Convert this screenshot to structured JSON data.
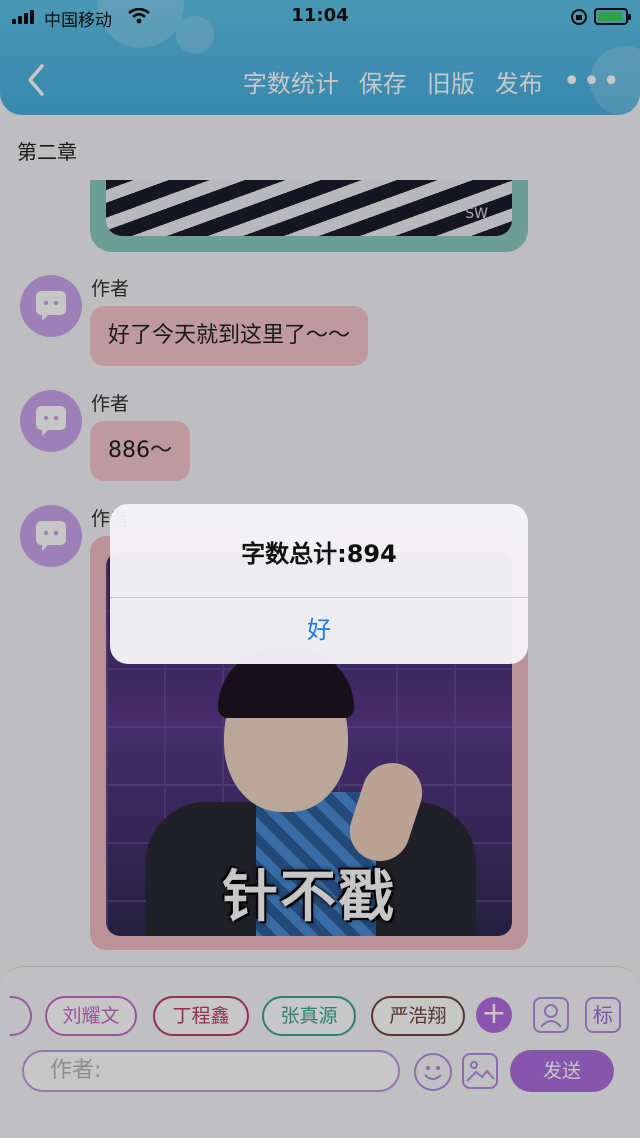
{
  "status_bar": {
    "carrier": "中国移动",
    "time": "11:04"
  },
  "header": {
    "actions": [
      "字数统计",
      "保存",
      "旧版",
      "发布"
    ],
    "more": "•••"
  },
  "chat": {
    "chapter": "第二章",
    "top_image_watermark": "SW",
    "messages": [
      {
        "author": "作者",
        "text": "好了今天就到这里了～～"
      },
      {
        "author": "作者",
        "text": "886～"
      }
    ],
    "image_message": {
      "author": "作者",
      "caption": "针不戳"
    }
  },
  "bottom_bar": {
    "chips": [
      "刘耀文",
      "丁程鑫",
      "张真源",
      "严浩翔"
    ],
    "chip_colors": [
      "#c86ac8",
      "#c03a6a",
      "#3ca68e",
      "#6a4a3a"
    ],
    "add": "+",
    "tag_button": "标",
    "input_placeholder": "作者:",
    "send": "发送"
  },
  "alert": {
    "title": "字数总计:894",
    "ok": "好"
  },
  "colors": {
    "header": "#48aee0",
    "accent_purple": "#ab6fdd",
    "bubble_pink": "#f4c6cd",
    "link_blue": "#1a7cf0"
  }
}
